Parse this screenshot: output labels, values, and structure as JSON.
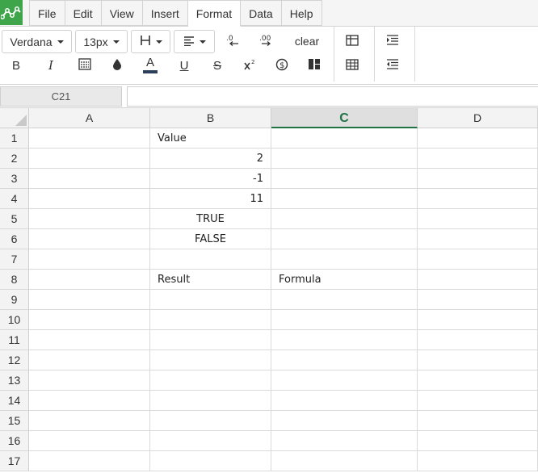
{
  "app": {
    "logo_icon": "chart-line-logo-icon",
    "brand_color": "#3fa54a",
    "accent_color": "#217346"
  },
  "menu": {
    "tabs": [
      {
        "label": "File"
      },
      {
        "label": "Edit"
      },
      {
        "label": "View"
      },
      {
        "label": "Insert"
      },
      {
        "label": "Format",
        "active": true
      },
      {
        "label": "Data"
      },
      {
        "label": "Help"
      }
    ]
  },
  "toolbar": {
    "font_family": "Verdana",
    "font_size": "13px",
    "clear_label": "clear",
    "icons": [
      "borders-icon",
      "align-left-icon",
      "decrease-decimals-icon",
      "increase-decimals-icon",
      "bold-icon",
      "italic-icon",
      "wrap-icon",
      "fill-color-icon",
      "text-color-icon",
      "underline-icon",
      "strikethrough-icon",
      "superscript-icon",
      "currency-icon",
      "merge-cells-icon",
      "table-icon",
      "grid-icon",
      "indent-icon",
      "outdent-icon"
    ]
  },
  "formula_bar": {
    "cell_ref": "C21",
    "formula": ""
  },
  "sheet": {
    "selected_column": "C",
    "columns": [
      "A",
      "B",
      "C",
      "D"
    ],
    "rows": [
      {
        "num": "1",
        "cells": [
          "",
          "Value",
          "",
          ""
        ]
      },
      {
        "num": "2",
        "cells": [
          "",
          "2",
          "",
          ""
        ]
      },
      {
        "num": "3",
        "cells": [
          "",
          "-1",
          "",
          ""
        ]
      },
      {
        "num": "4",
        "cells": [
          "",
          "11",
          "",
          ""
        ]
      },
      {
        "num": "5",
        "cells": [
          "",
          "TRUE",
          "",
          ""
        ]
      },
      {
        "num": "6",
        "cells": [
          "",
          "FALSE",
          "",
          ""
        ]
      },
      {
        "num": "7",
        "cells": [
          "",
          "",
          "",
          ""
        ]
      },
      {
        "num": "8",
        "cells": [
          "",
          "Result",
          "Formula",
          ""
        ]
      },
      {
        "num": "9",
        "cells": [
          "",
          "",
          "",
          ""
        ]
      },
      {
        "num": "10",
        "cells": [
          "",
          "",
          "",
          ""
        ]
      },
      {
        "num": "11",
        "cells": [
          "",
          "",
          "",
          ""
        ]
      },
      {
        "num": "12",
        "cells": [
          "",
          "",
          "",
          ""
        ]
      },
      {
        "num": "13",
        "cells": [
          "",
          "",
          "",
          ""
        ]
      },
      {
        "num": "14",
        "cells": [
          "",
          "",
          "",
          ""
        ]
      },
      {
        "num": "15",
        "cells": [
          "",
          "",
          "",
          ""
        ]
      },
      {
        "num": "16",
        "cells": [
          "",
          "",
          "",
          ""
        ]
      },
      {
        "num": "17",
        "cells": [
          "",
          "",
          "",
          ""
        ]
      }
    ],
    "alignments": [
      [
        "",
        "left",
        "",
        ""
      ],
      [
        "",
        "right",
        "",
        ""
      ],
      [
        "",
        "right",
        "",
        ""
      ],
      [
        "",
        "right",
        "",
        ""
      ],
      [
        "",
        "center",
        "",
        ""
      ],
      [
        "",
        "center",
        "",
        ""
      ],
      [
        "",
        "",
        "",
        ""
      ],
      [
        "",
        "left",
        "left",
        ""
      ]
    ]
  }
}
